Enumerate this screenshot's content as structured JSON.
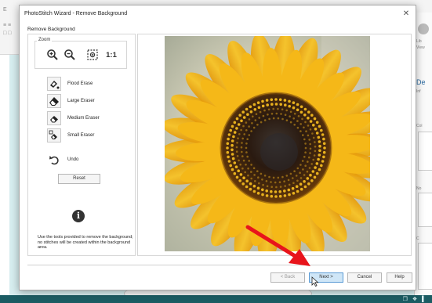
{
  "background_app": {
    "ribbon_letter": "E",
    "ribbon_icons_text": "≡ ≡\n□ □",
    "right_panel": {
      "label_lib": "Lib",
      "label_view": "View",
      "header": "De",
      "label_info": "Inf",
      "label_col": "Col",
      "label_no": "No",
      "label_c": "C"
    },
    "footer_icons": "❐ ❖ ▌"
  },
  "dialog": {
    "title": "PhotoStitch Wizard - Remove Background",
    "close_glyph": "✕",
    "section_label": "Remove Background"
  },
  "tools": {
    "zoom_caption": "Zoom",
    "zoom_actual_label": "1:1",
    "items": [
      {
        "label": "Flood Erase",
        "icon": "flood-erase-icon"
      },
      {
        "label": "Large Eraser",
        "icon": "large-eraser-icon"
      },
      {
        "label": "Medium Eraser",
        "icon": "medium-eraser-icon"
      },
      {
        "label": "Small Eraser",
        "icon": "small-eraser-icon"
      }
    ],
    "undo_label": "Undo",
    "reset_label": "Reset",
    "info_glyph": "i",
    "help_text": "Use the tools provided to remove the background; no stitches will be created within the background area."
  },
  "footer": {
    "back_label": "< Back",
    "next_label": "Next >",
    "cancel_label": "Cancel",
    "help_label": "Help"
  },
  "colors": {
    "accent": "#2b6aa0",
    "annotation_arrow": "#e8141b",
    "petal": "#f2b516",
    "disk": "#2a1a10"
  }
}
